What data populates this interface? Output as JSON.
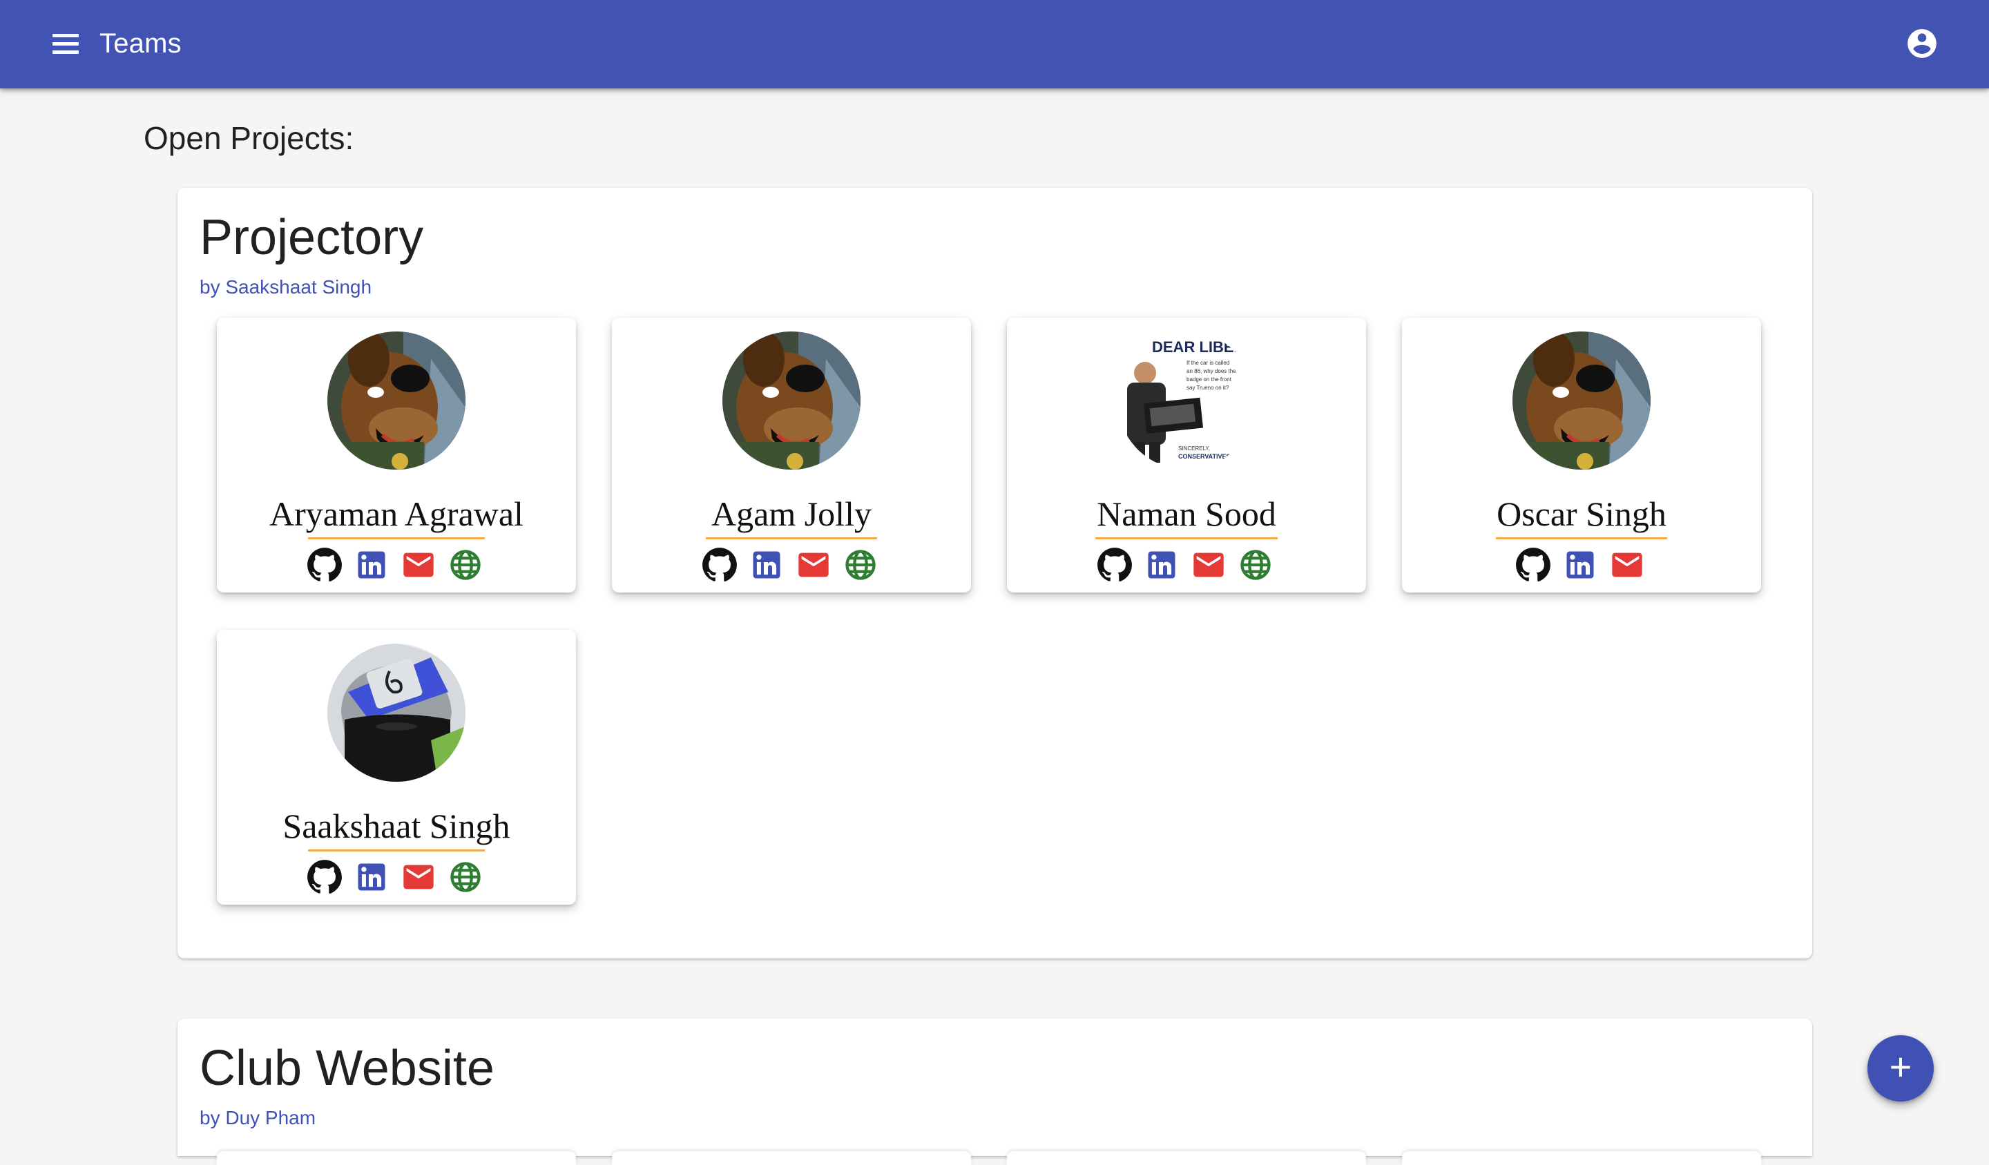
{
  "app": {
    "title": "Teams"
  },
  "heading": "Open Projects:",
  "projects": [
    {
      "title": "Projectory",
      "author": "by Saakshaat Singh",
      "members": [
        {
          "name": "Aryaman Agrawal",
          "avatar": "cartoon-dog-avatar",
          "links": [
            "github",
            "linkedin",
            "email",
            "website"
          ]
        },
        {
          "name": "Agam Jolly",
          "avatar": "cartoon-dog-avatar",
          "links": [
            "github",
            "linkedin",
            "email",
            "website"
          ]
        },
        {
          "name": "Naman Sood",
          "avatar": "meme-poster-avatar",
          "avatar_text": {
            "headline": "DEAR LIBERA",
            "body": "If the car is called an 86, why does the badge on the front say Trueno on it?",
            "signoff": "SINCERELY, CONSERVATIVES"
          },
          "links": [
            "github",
            "linkedin",
            "email",
            "website"
          ]
        },
        {
          "name": "Oscar Singh",
          "avatar": "cartoon-dog-avatar",
          "links": [
            "github",
            "linkedin",
            "email"
          ]
        },
        {
          "name": "Saakshaat Singh",
          "avatar": "masked-ninja-avatar",
          "links": [
            "github",
            "linkedin",
            "email",
            "website"
          ]
        }
      ]
    },
    {
      "title": "Club Website",
      "author": "by Duy Pham",
      "members": []
    }
  ],
  "fab": {
    "label": "+"
  },
  "colors": {
    "appbar": "#4353b3",
    "accent": "#3f51b5",
    "underline": "#f3a94a",
    "email": "#e53935",
    "website": "#2e7d32",
    "linkedin": "#3f51b5"
  }
}
